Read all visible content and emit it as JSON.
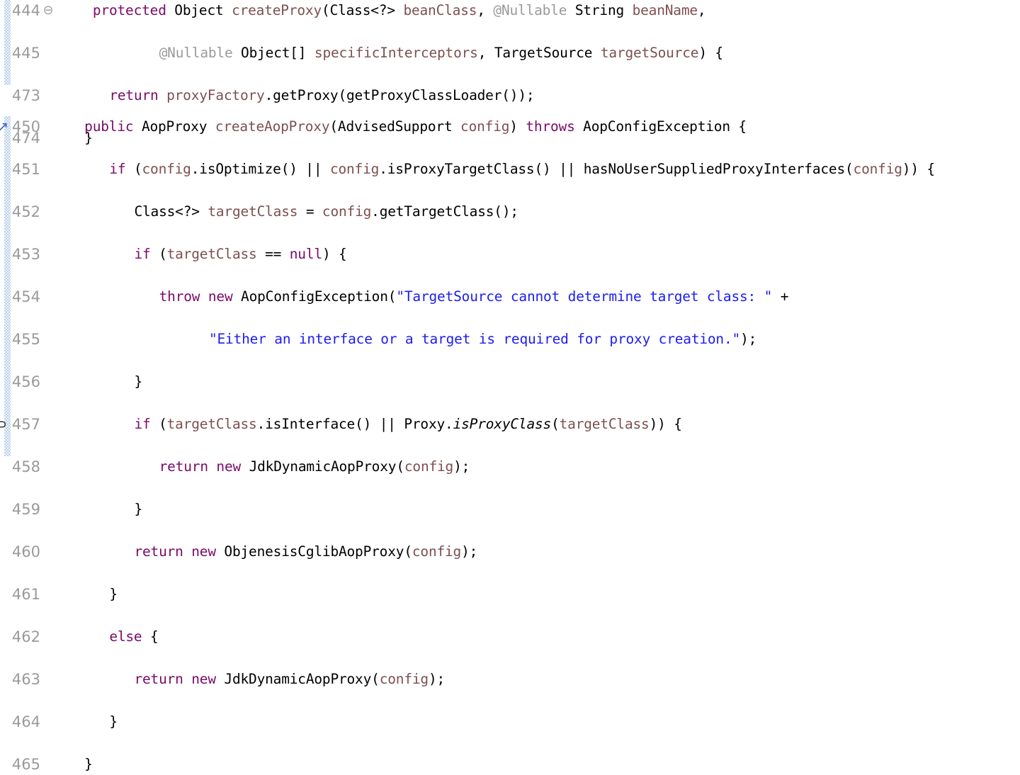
{
  "editor": {
    "kind": "java-source-code-viewer",
    "colors": {
      "background": "#ffffff",
      "gutter_strip": "#aecbe8",
      "line_number": "#999a9b",
      "keyword": "#7a0a68",
      "identifier": "#7d5050",
      "type": "#000000",
      "string": "#1d1df0",
      "annotation": "#9a9a9a",
      "override_marker": "#3b5fc0"
    },
    "blocks": [
      {
        "name": "create-proxy-block",
        "lines": [
          {
            "number": "444",
            "marker": "fold-collapse-icon",
            "marker_glyph": "⊖",
            "indent": 4,
            "tokens": [
              {
                "t": "protected ",
                "c": "kw"
              },
              {
                "t": "Object ",
                "c": "type"
              },
              {
                "t": "createProxy",
                "c": "ident"
              },
              {
                "t": "(",
                "c": "punc"
              },
              {
                "t": "Class",
                "c": "type"
              },
              {
                "t": "<?> ",
                "c": "punc"
              },
              {
                "t": "beanClass",
                "c": "ident"
              },
              {
                "t": ", ",
                "c": "punc"
              },
              {
                "t": "@Nullable ",
                "c": "anno"
              },
              {
                "t": "String ",
                "c": "type"
              },
              {
                "t": "beanName",
                "c": "ident"
              },
              {
                "t": ",",
                "c": "punc"
              }
            ]
          },
          {
            "number": "445",
            "marker": "",
            "marker_glyph": "",
            "indent": 12,
            "tokens": [
              {
                "t": "@Nullable ",
                "c": "anno"
              },
              {
                "t": "Object[] ",
                "c": "type"
              },
              {
                "t": "specificInterceptors",
                "c": "ident"
              },
              {
                "t": ", ",
                "c": "punc"
              },
              {
                "t": "TargetSource ",
                "c": "type"
              },
              {
                "t": "targetSource",
                "c": "ident"
              },
              {
                "t": ") {",
                "c": "punc"
              }
            ]
          },
          {
            "number": "473",
            "marker": "",
            "marker_glyph": "",
            "indent": 6,
            "tokens": [
              {
                "t": "return ",
                "c": "kw"
              },
              {
                "t": "proxyFactory",
                "c": "ident"
              },
              {
                "t": ".",
                "c": "punc"
              },
              {
                "t": "getProxy",
                "c": "type"
              },
              {
                "t": "(",
                "c": "punc"
              },
              {
                "t": "getProxyClassLoader",
                "c": "type"
              },
              {
                "t": "());",
                "c": "punc"
              }
            ]
          },
          {
            "number": "474",
            "marker": "",
            "marker_glyph": "",
            "indent": 3,
            "tokens": [
              {
                "t": "}",
                "c": "punc"
              }
            ]
          }
        ]
      },
      {
        "name": "create-aop-proxy-block",
        "lines": [
          {
            "number": "450",
            "marker": "override-method-icon",
            "marker_glyph": "↗",
            "indent": 3,
            "tokens": [
              {
                "t": "public ",
                "c": "kw"
              },
              {
                "t": "AopProxy ",
                "c": "type"
              },
              {
                "t": "createAopProxy",
                "c": "ident"
              },
              {
                "t": "(",
                "c": "punc"
              },
              {
                "t": "AdvisedSupport ",
                "c": "type"
              },
              {
                "t": "config",
                "c": "ident"
              },
              {
                "t": ") ",
                "c": "punc"
              },
              {
                "t": "throws ",
                "c": "kw"
              },
              {
                "t": "AopConfigException ",
                "c": "type"
              },
              {
                "t": "{",
                "c": "punc"
              }
            ]
          },
          {
            "number": "451",
            "marker": "",
            "marker_glyph": "",
            "indent": 6,
            "tokens": [
              {
                "t": "if ",
                "c": "kw"
              },
              {
                "t": "(",
                "c": "punc"
              },
              {
                "t": "config",
                "c": "ident"
              },
              {
                "t": ".",
                "c": "punc"
              },
              {
                "t": "isOptimize",
                "c": "type"
              },
              {
                "t": "() || ",
                "c": "punc"
              },
              {
                "t": "config",
                "c": "ident"
              },
              {
                "t": ".",
                "c": "punc"
              },
              {
                "t": "isProxyTargetClass",
                "c": "type"
              },
              {
                "t": "() || ",
                "c": "punc"
              },
              {
                "t": "hasNoUserSuppliedProxyInterfaces",
                "c": "type"
              },
              {
                "t": "(",
                "c": "punc"
              },
              {
                "t": "config",
                "c": "ident"
              },
              {
                "t": ")) {",
                "c": "punc"
              }
            ]
          },
          {
            "number": "452",
            "marker": "",
            "marker_glyph": "",
            "indent": 9,
            "tokens": [
              {
                "t": "Class",
                "c": "type"
              },
              {
                "t": "<?> ",
                "c": "punc"
              },
              {
                "t": "targetClass",
                "c": "ident"
              },
              {
                "t": " = ",
                "c": "punc"
              },
              {
                "t": "config",
                "c": "ident"
              },
              {
                "t": ".",
                "c": "punc"
              },
              {
                "t": "getTargetClass",
                "c": "type"
              },
              {
                "t": "();",
                "c": "punc"
              }
            ]
          },
          {
            "number": "453",
            "marker": "",
            "marker_glyph": "",
            "indent": 9,
            "tokens": [
              {
                "t": "if ",
                "c": "kw"
              },
              {
                "t": "(",
                "c": "punc"
              },
              {
                "t": "targetClass",
                "c": "ident"
              },
              {
                "t": " == ",
                "c": "punc"
              },
              {
                "t": "null",
                "c": "kw"
              },
              {
                "t": ") {",
                "c": "punc"
              }
            ]
          },
          {
            "number": "454",
            "marker": "",
            "marker_glyph": "",
            "indent": 12,
            "tokens": [
              {
                "t": "throw ",
                "c": "kw"
              },
              {
                "t": "new ",
                "c": "kw"
              },
              {
                "t": "AopConfigException",
                "c": "type"
              },
              {
                "t": "(",
                "c": "punc"
              },
              {
                "t": "\"TargetSource cannot determine target class: \"",
                "c": "str"
              },
              {
                "t": " +",
                "c": "punc"
              }
            ]
          },
          {
            "number": "455",
            "marker": "",
            "marker_glyph": "",
            "indent": 18,
            "tokens": [
              {
                "t": "\"Either an interface or a target is required for proxy creation.\"",
                "c": "str"
              },
              {
                "t": ");",
                "c": "punc"
              }
            ]
          },
          {
            "number": "456",
            "marker": "",
            "marker_glyph": "",
            "indent": 9,
            "tokens": [
              {
                "t": "}",
                "c": "punc"
              }
            ]
          },
          {
            "number": "457",
            "marker": "implements-method-icon",
            "marker_glyph": "⊃",
            "indent": 9,
            "tokens": [
              {
                "t": "if ",
                "c": "kw"
              },
              {
                "t": "(",
                "c": "punc"
              },
              {
                "t": "targetClass",
                "c": "ident"
              },
              {
                "t": ".",
                "c": "punc"
              },
              {
                "t": "isInterface",
                "c": "type"
              },
              {
                "t": "() || ",
                "c": "punc"
              },
              {
                "t": "Proxy",
                "c": "type"
              },
              {
                "t": ".",
                "c": "punc"
              },
              {
                "t": "isProxyClass",
                "c": "type ital"
              },
              {
                "t": "(",
                "c": "punc"
              },
              {
                "t": "targetClass",
                "c": "ident"
              },
              {
                "t": ")) {",
                "c": "punc"
              }
            ]
          },
          {
            "number": "458",
            "marker": "",
            "marker_glyph": "",
            "indent": 12,
            "tokens": [
              {
                "t": "return ",
                "c": "kw"
              },
              {
                "t": "new ",
                "c": "kw"
              },
              {
                "t": "JdkDynamicAopProxy",
                "c": "type"
              },
              {
                "t": "(",
                "c": "punc"
              },
              {
                "t": "config",
                "c": "ident"
              },
              {
                "t": ");",
                "c": "punc"
              }
            ]
          },
          {
            "number": "459",
            "marker": "",
            "marker_glyph": "",
            "indent": 9,
            "tokens": [
              {
                "t": "}",
                "c": "punc"
              }
            ]
          },
          {
            "number": "460",
            "marker": "",
            "marker_glyph": "",
            "indent": 9,
            "tokens": [
              {
                "t": "return ",
                "c": "kw"
              },
              {
                "t": "new ",
                "c": "kw"
              },
              {
                "t": "ObjenesisCglibAopProxy",
                "c": "type"
              },
              {
                "t": "(",
                "c": "punc"
              },
              {
                "t": "config",
                "c": "ident"
              },
              {
                "t": ");",
                "c": "punc"
              }
            ]
          },
          {
            "number": "461",
            "marker": "",
            "marker_glyph": "",
            "indent": 6,
            "tokens": [
              {
                "t": "}",
                "c": "punc"
              }
            ]
          },
          {
            "number": "462",
            "marker": "",
            "marker_glyph": "",
            "indent": 6,
            "tokens": [
              {
                "t": "else ",
                "c": "kw"
              },
              {
                "t": "{",
                "c": "punc"
              }
            ]
          },
          {
            "number": "463",
            "marker": "",
            "marker_glyph": "",
            "indent": 9,
            "tokens": [
              {
                "t": "return ",
                "c": "kw"
              },
              {
                "t": "new ",
                "c": "kw"
              },
              {
                "t": "JdkDynamicAopProxy",
                "c": "type"
              },
              {
                "t": "(",
                "c": "punc"
              },
              {
                "t": "config",
                "c": "ident"
              },
              {
                "t": ");",
                "c": "punc"
              }
            ]
          },
          {
            "number": "464",
            "marker": "",
            "marker_glyph": "",
            "indent": 6,
            "tokens": [
              {
                "t": "}",
                "c": "punc"
              }
            ]
          },
          {
            "number": "465",
            "marker": "",
            "marker_glyph": "",
            "indent": 3,
            "tokens": [
              {
                "t": "}",
                "c": "punc"
              }
            ]
          }
        ]
      }
    ]
  }
}
